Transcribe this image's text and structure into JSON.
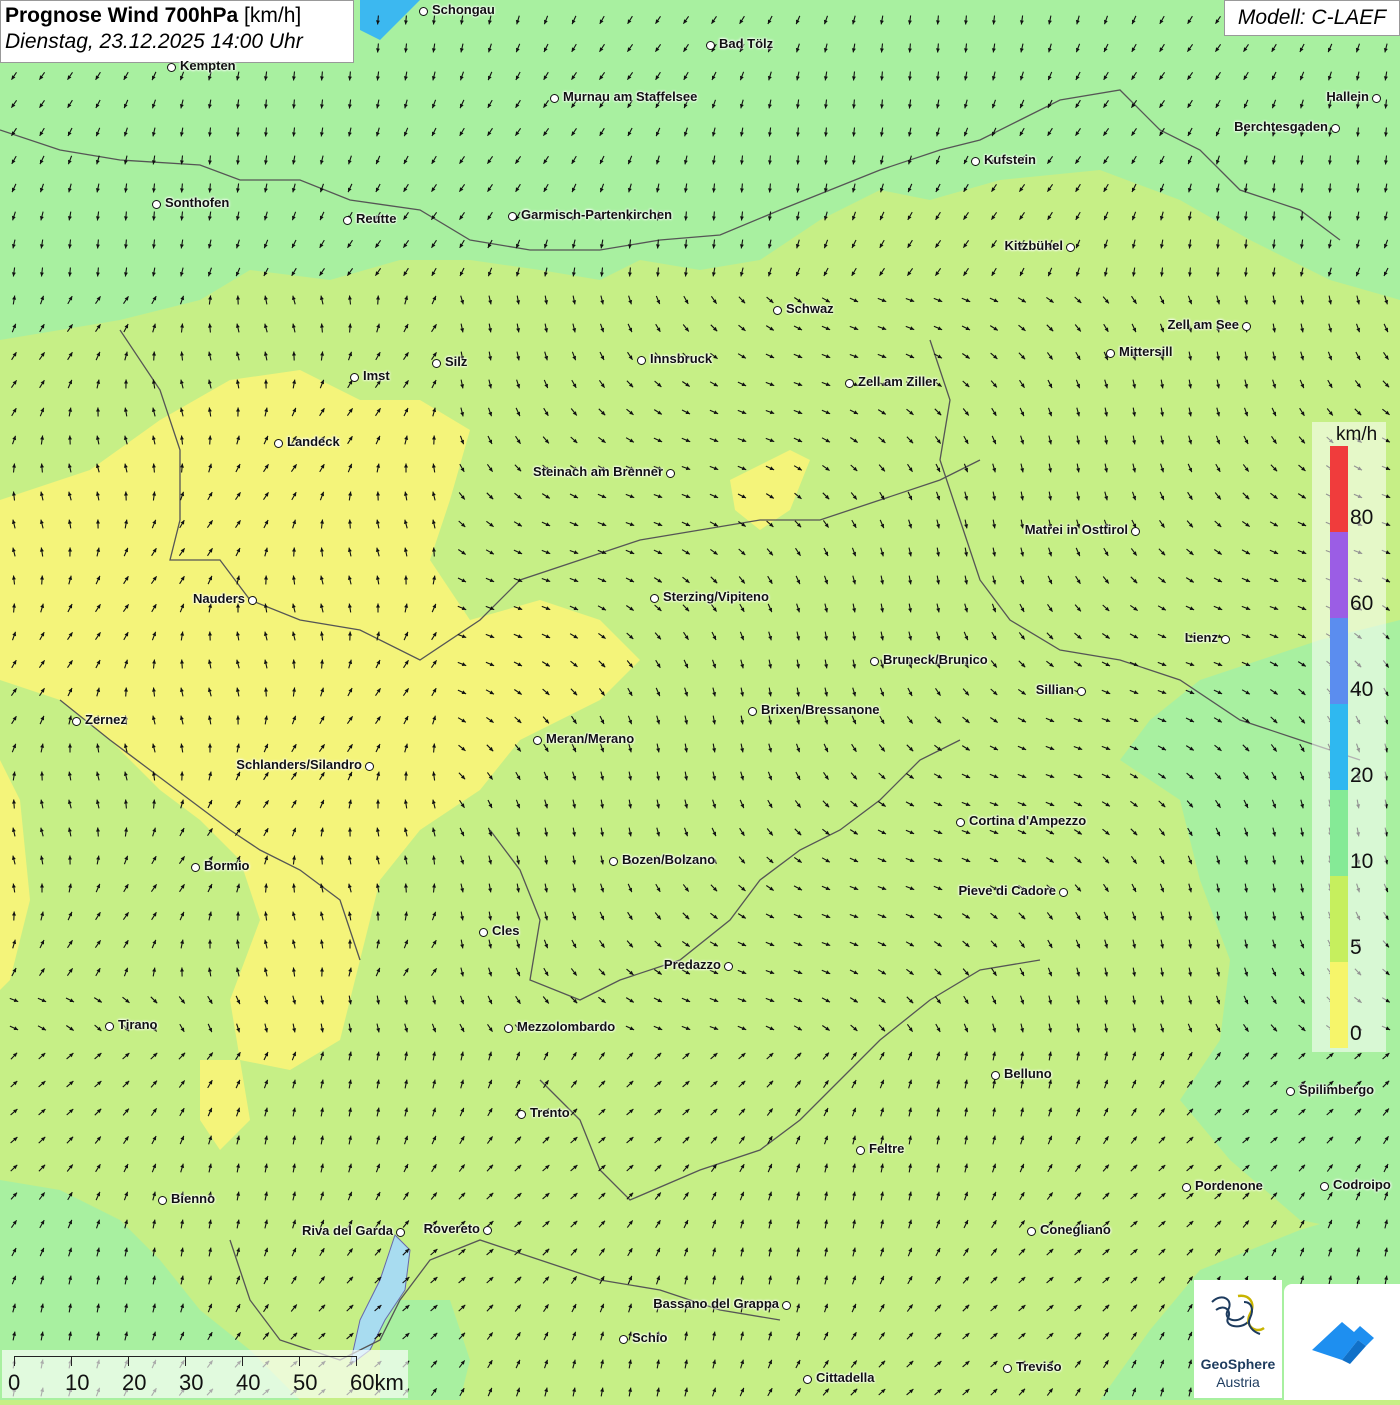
{
  "header": {
    "title_bold": "Prognose Wind 700hPa",
    "title_unit": "[km/h]",
    "datetime": "Dienstag, 23.12.2025 14:00 Uhr",
    "model": "Modell: C-LAEF"
  },
  "legend": {
    "unit": "km/h",
    "labels": [
      "80",
      "60",
      "40",
      "20",
      "10",
      "5",
      "0"
    ],
    "colors": [
      "#f03c3c",
      "#9b5de5",
      "#5b8def",
      "#2fb8f0",
      "#85ea96",
      "#c6ef5e",
      "#f6f56a"
    ]
  },
  "scale": {
    "labels": [
      "0",
      "10",
      "20",
      "30",
      "40",
      "50",
      "60km"
    ]
  },
  "places": [
    {
      "name": "Schongau"
    },
    {
      "name": "Bad Tölz"
    },
    {
      "name": "Kempten"
    },
    {
      "name": "Murnau am Staffelsee"
    },
    {
      "name": "Hallein"
    },
    {
      "name": "Berchtesgaden"
    },
    {
      "name": "Kufstein"
    },
    {
      "name": "Sonthofen"
    },
    {
      "name": "Reutte"
    },
    {
      "name": "Garmisch-Partenkirchen"
    },
    {
      "name": "Kitzbühel"
    },
    {
      "name": "Schwaz"
    },
    {
      "name": "Zell am See"
    },
    {
      "name": "Mittersill"
    },
    {
      "name": "Innsbruck"
    },
    {
      "name": "Silz"
    },
    {
      "name": "Imst"
    },
    {
      "name": "Zell am Ziller"
    },
    {
      "name": "Landeck"
    },
    {
      "name": "Steinach am Brenner"
    },
    {
      "name": "Matrei in Osttirol"
    },
    {
      "name": "Nauders"
    },
    {
      "name": "Sterzing/Vipiteno"
    },
    {
      "name": "Lienz"
    },
    {
      "name": "Bruneck/Brunico"
    },
    {
      "name": "Sillian"
    },
    {
      "name": "Zernez"
    },
    {
      "name": "Brixen/Bressanone"
    },
    {
      "name": "Meran/Merano"
    },
    {
      "name": "Schlanders/Silandro"
    },
    {
      "name": "Cortina d'Ampezzo"
    },
    {
      "name": "Bozen/Bolzano"
    },
    {
      "name": "Bormio"
    },
    {
      "name": "Pieve di Cadore"
    },
    {
      "name": "Cles"
    },
    {
      "name": "Predazzo"
    },
    {
      "name": "Tirano"
    },
    {
      "name": "Mezzolombardo"
    },
    {
      "name": "Belluno"
    },
    {
      "name": "Spilimbergo"
    },
    {
      "name": "Trento"
    },
    {
      "name": "Feltre"
    },
    {
      "name": "Pordenone"
    },
    {
      "name": "Codroipo"
    },
    {
      "name": "Bienno"
    },
    {
      "name": "Riva del Garda"
    },
    {
      "name": "Rovereto"
    },
    {
      "name": "Conegliano"
    },
    {
      "name": "Bassano del Grappa"
    },
    {
      "name": "Schio"
    },
    {
      "name": "Treviso"
    },
    {
      "name": "Cittadella"
    }
  ],
  "logos": {
    "geosphere_line1": "GeoSphere",
    "geosphere_line2": "Austria"
  },
  "colors": {
    "wind_0_5": "#f6f56a",
    "wind_5_10": "#c6ef5e",
    "wind_10_20": "#9cec8e",
    "water": "#3cb8f0"
  }
}
